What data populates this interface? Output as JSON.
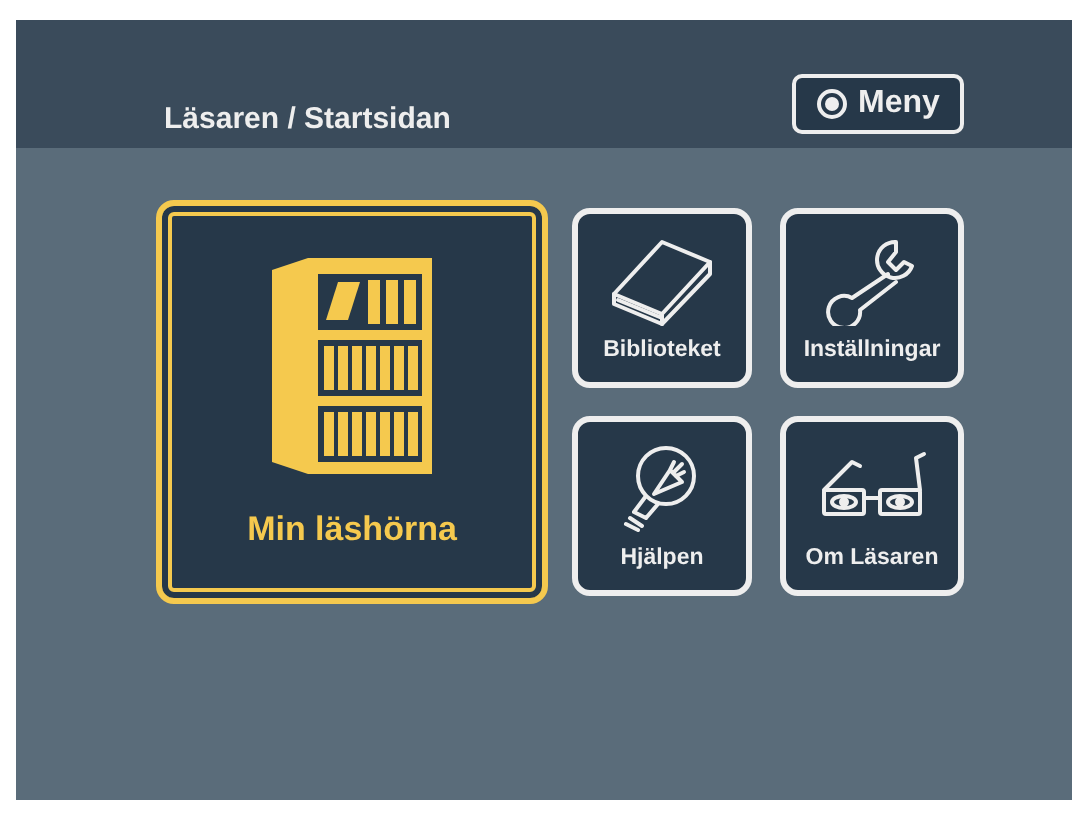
{
  "header": {
    "title": "Läsaren / Startsidan",
    "menu_button": "Meny"
  },
  "tiles": [
    {
      "label": "Min läshörna",
      "selected": true
    },
    {
      "label": "Biblioteket",
      "selected": false
    },
    {
      "label": "Inställningar",
      "selected": false
    },
    {
      "label": "Hjälpen",
      "selected": false
    },
    {
      "label": "Om Läsaren",
      "selected": false
    }
  ]
}
